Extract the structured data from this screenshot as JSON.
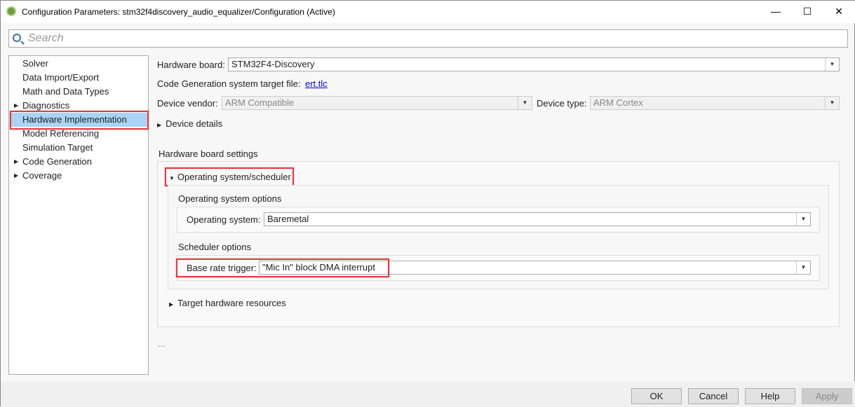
{
  "window": {
    "title": "Configuration Parameters: stm32f4discovery_audio_equalizer/Configuration (Active)",
    "minimize": "—",
    "maximize": "☐",
    "close": "✕"
  },
  "search": {
    "placeholder": "Search"
  },
  "sidebar": {
    "items": [
      {
        "label": "Solver",
        "expandable": false
      },
      {
        "label": "Data Import/Export",
        "expandable": false
      },
      {
        "label": "Math and Data Types",
        "expandable": false
      },
      {
        "label": "Diagnostics",
        "expandable": true
      },
      {
        "label": "Hardware Implementation",
        "expandable": false,
        "selected": true
      },
      {
        "label": "Model Referencing",
        "expandable": false
      },
      {
        "label": "Simulation Target",
        "expandable": false
      },
      {
        "label": "Code Generation",
        "expandable": true
      },
      {
        "label": "Coverage",
        "expandable": true
      }
    ]
  },
  "main": {
    "hardware_board_label": "Hardware board:",
    "hardware_board_value": "STM32F4-Discovery",
    "target_file_label": "Code Generation system target file:",
    "target_file_link": "ert.tlc",
    "device_vendor_label": "Device vendor:",
    "device_vendor_value": "ARM Compatible",
    "device_type_label": "Device type:",
    "device_type_value": "ARM Cortex",
    "device_details": "Device details",
    "board_settings": "Hardware board settings",
    "os_scheduler": "Operating system/scheduler",
    "os_options": "Operating system options",
    "os_label": "Operating system:",
    "os_value": "Baremetal",
    "scheduler_options": "Scheduler options",
    "base_rate_label": "Base rate trigger:",
    "base_rate_value": "\"Mic In\" block DMA interrupt",
    "target_resources": "Target hardware resources",
    "ellipsis": "..."
  },
  "buttons": {
    "ok": "OK",
    "cancel": "Cancel",
    "help": "Help",
    "apply": "Apply"
  },
  "colors": {
    "highlight": "#e8383d",
    "selection": "#a9d4f5",
    "link": "#0000ee"
  }
}
